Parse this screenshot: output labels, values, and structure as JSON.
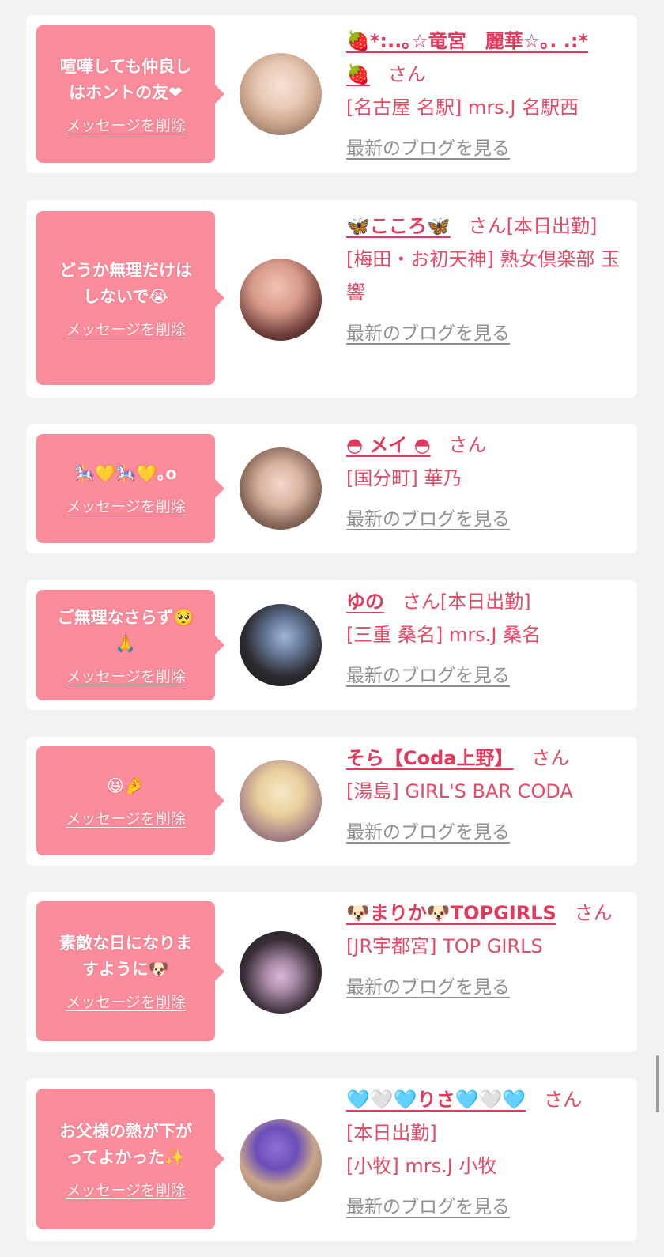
{
  "colors": {
    "bubble": "#fb8c9b",
    "name": "#e3395c",
    "shop": "#e24a66",
    "blog_link": "#8f8f8f",
    "background": "#f2f2f2"
  },
  "delete_label": "メッセージを削除",
  "san": "さん",
  "blog_label": "最新のブログを見る",
  "entries": [
    {
      "message": "喧嘩しても仲良し\nはホントの友❤",
      "name": "🍓*:..｡☆竜宮　麗華☆｡. .:*🍓",
      "status": "",
      "shop": "[名古屋 名駅] mrs.J 名駅西",
      "avatar_icon": "avatar-photo-icon"
    },
    {
      "message": "どうか無理だけは\nしないで😭",
      "name": "🦋こころ🦋",
      "status": "[本日出勤]",
      "shop": "[梅田・お初天神] 熟女倶楽部 玉響",
      "avatar_icon": "avatar-photo-icon"
    },
    {
      "message": "🎠💛🎠💛｡o",
      "name": "◓ メイ ◓",
      "status": "",
      "shop": "[国分町] 華乃",
      "avatar_icon": "avatar-photo-icon"
    },
    {
      "message": "ご無理なさらず🥺\n🙏",
      "name": "ゆの",
      "status": "[本日出勤]",
      "shop": "[三重 桑名] mrs.J 桑名",
      "avatar_icon": "avatar-photo-icon"
    },
    {
      "message": "😆🤌",
      "name": "そら【Coda上野】",
      "status": "",
      "shop": "[湯島] GIRL'S BAR CODA",
      "avatar_icon": "avatar-photo-icon"
    },
    {
      "message": "素敵な日になりま\nすように🐶",
      "name": "🐶まりか🐶TOPGIRLS",
      "status": "",
      "shop": "[JR宇都宮] TOP GIRLS",
      "avatar_icon": "avatar-photo-icon"
    },
    {
      "message": "お父様の熱が下が\nってよかった✨",
      "name": "🩵🤍🩵りさ🩵🤍🩵",
      "status": "[本日出勤]",
      "shop": "[小牧] mrs.J 小牧",
      "avatar_icon": "avatar-photo-icon"
    }
  ]
}
